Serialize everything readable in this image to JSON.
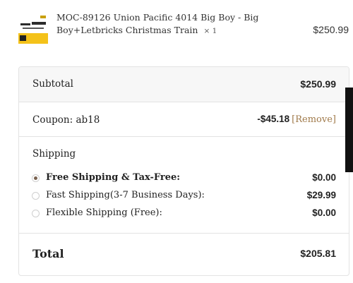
{
  "product": {
    "name": "MOC-89126 Union Pacific 4014 Big Boy - Big Boy+Letbricks Christmas Train",
    "qty": "× 1",
    "price": "$250.99",
    "thumb_color": "#f4c21a"
  },
  "totals": {
    "subtotal_label": "Subtotal",
    "subtotal_value": "$250.99",
    "coupon_label": "Coupon: ab18",
    "coupon_value": "-$45.18",
    "coupon_remove": "[Remove]",
    "shipping_label": "Shipping",
    "shipping_options": [
      {
        "label": "Free Shipping & Tax-Free:",
        "price": "$0.00",
        "selected": true
      },
      {
        "label": "Fast Shipping(3-7 Business Days):",
        "price": "$29.99",
        "selected": false
      },
      {
        "label": "Flexible Shipping (Free):",
        "price": "$0.00",
        "selected": false
      }
    ],
    "total_label": "Total",
    "total_value": "$205.81"
  },
  "colors": {
    "remove_link": "#a07a4a",
    "radio_selected": "#7a6250",
    "subtotal_bg": "#f7f7f7"
  }
}
